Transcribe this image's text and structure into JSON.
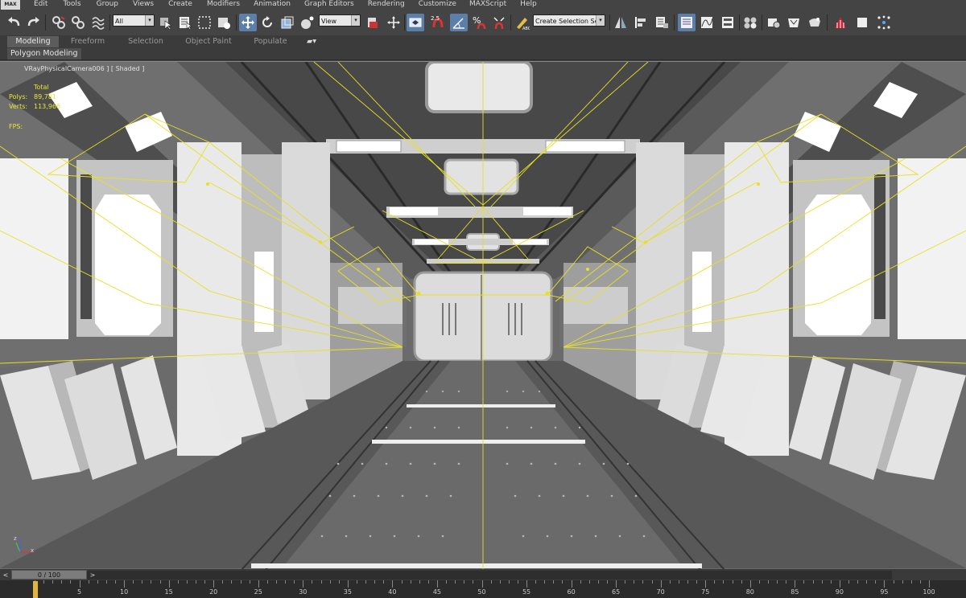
{
  "app": {
    "logo": "MAX"
  },
  "menu": [
    "Edit",
    "Tools",
    "Group",
    "Views",
    "Create",
    "Modifiers",
    "Animation",
    "Graph Editors",
    "Rendering",
    "Customize",
    "MAXScript",
    "Help"
  ],
  "toolbar": {
    "selection_filter": "All",
    "ref_coord": "View",
    "snap_label": "2.5",
    "named_selection": "Create Selection Se"
  },
  "ribbon": {
    "tabs": [
      "Modeling",
      "Freeform",
      "Selection",
      "Object Paint",
      "Populate"
    ],
    "active_tab": "Modeling",
    "subpanel": "Polygon Modeling"
  },
  "viewport": {
    "label": "[ + ] [ VRayPhysicalCamera006 ] [ Shaded ]",
    "label_visible": "VRayPhysicalCamera006 ] [ Shaded ]",
    "stats": {
      "total_label": "Total",
      "polys_label": "Polys:",
      "polys_value": "89,781",
      "verts_label": "Verts:",
      "verts_value": "113,966",
      "fps_label": "FPS:"
    },
    "gizmo_axes": {
      "x": "x",
      "z": "z"
    }
  },
  "timeline": {
    "frame_display": "0 / 100",
    "prev_label": "<",
    "next_label": ">",
    "ticks": [
      0,
      5,
      10,
      15,
      20,
      25,
      30,
      35,
      40,
      45,
      50,
      55,
      60,
      65,
      70,
      75,
      80,
      85,
      90,
      95,
      100
    ],
    "current_frame": 0
  },
  "colors": {
    "accent": "#5b7fa8",
    "camera_lines": "#e8e020",
    "time_marker": "#e3b53b"
  }
}
